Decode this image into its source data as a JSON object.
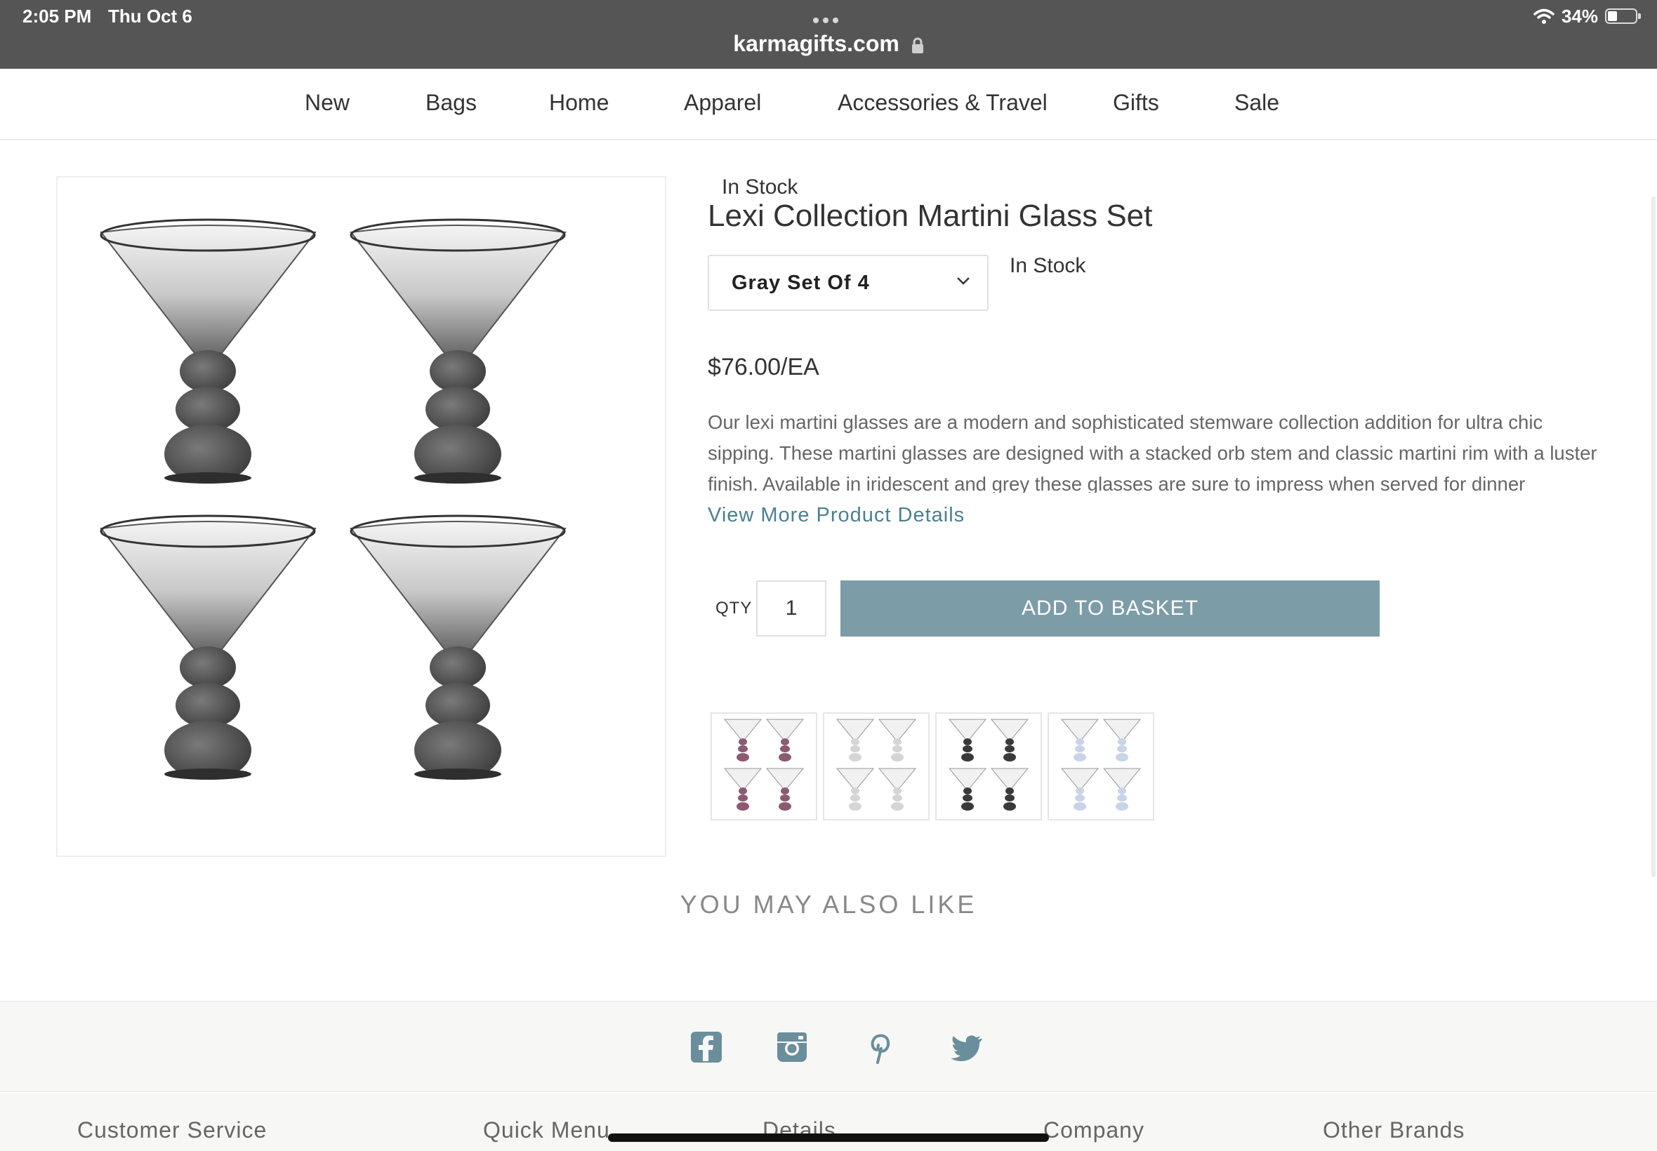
{
  "status_bar": {
    "time": "2:05 PM",
    "date": "Thu Oct 6",
    "url": "karmagifts.com",
    "battery": "34%",
    "battery_level": 0.34
  },
  "nav": {
    "items": [
      "New",
      "Bags",
      "Home",
      "Apparel",
      "Accessories & Travel",
      "Gifts",
      "Sale"
    ]
  },
  "product": {
    "stock_top": "In Stock",
    "title": "Lexi Collection Martini Glass Set",
    "variant": "Gray Set Of 4",
    "stock_right": "In Stock",
    "price": "$76.00/EA",
    "description": "Our lexi martini glasses are a modern and sophisticated stemware collection addition for ultra chic sipping. These martini glasses are designed with a stacked orb stem and classic martini rim with a luster finish. Available in iridescent and grey these glasses are sure to impress when served for dinner",
    "view_more": "View More Product Details",
    "qty_label": "QTY",
    "qty_value": "1",
    "add_button": "ADD TO BASKET",
    "thumbnails": [
      {
        "name": "pink",
        "color": "#8c5a72"
      },
      {
        "name": "clear",
        "color": "#d5d5d5"
      },
      {
        "name": "gray",
        "color": "#3a3a3a"
      },
      {
        "name": "iridescent",
        "color": "#c8d4e8"
      }
    ]
  },
  "also_like": "YOU MAY ALSO LIKE",
  "footer": {
    "social": [
      "facebook-icon",
      "instagram-icon",
      "pinterest-icon",
      "twitter-icon"
    ],
    "social_color": "#6a8e9c",
    "links": [
      "Customer Service",
      "Quick Menu",
      "Details",
      "Company",
      "Other Brands"
    ]
  },
  "colors": {
    "accent_button": "#7c9ca8",
    "link": "#4a7f93",
    "status_bar_bg": "#555555"
  }
}
